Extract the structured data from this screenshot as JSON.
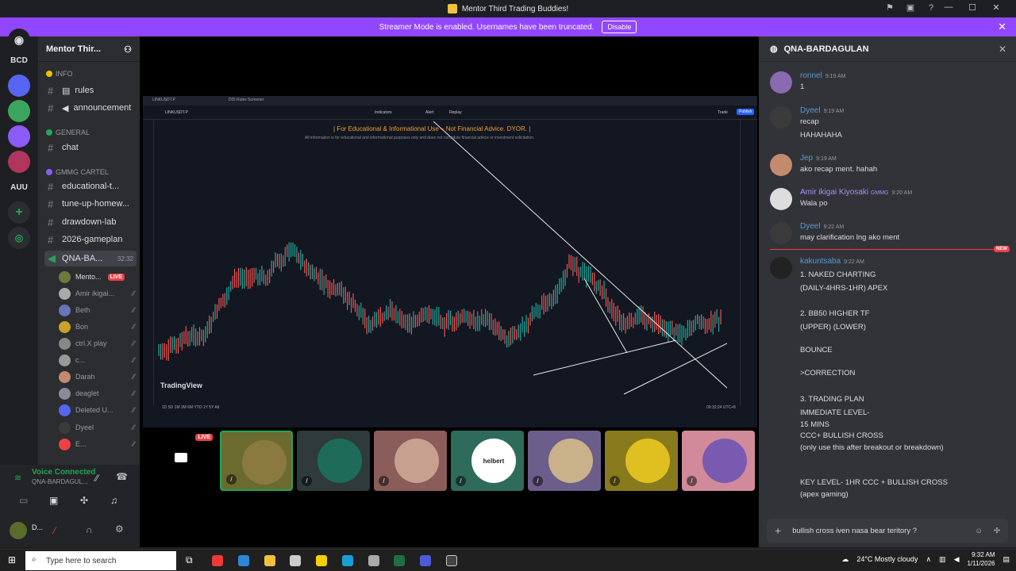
{
  "window": {
    "title": "Mentor Third Trading Buddies!"
  },
  "banner": {
    "text": "Streamer Mode is enabled. Usernames have been truncated.",
    "button": "Disable"
  },
  "rail": {
    "servers": [
      "BCD",
      "AUU"
    ]
  },
  "sidebar": {
    "server_name": "Mentor Thir...",
    "categories": [
      "INFO",
      "GENERAL",
      "GMMG CARTEL"
    ],
    "channels": [
      {
        "name": "rules",
        "icon": "document-icon"
      },
      {
        "name": "announcement",
        "icon": "megaphone-icon"
      },
      {
        "name": "chat"
      },
      {
        "name": "educational-t..."
      },
      {
        "name": "tune-up-homew..."
      },
      {
        "name": "drawdown-lab"
      },
      {
        "name": "2026-gameplan"
      }
    ],
    "voice_channel": {
      "name": "QNA-BA...",
      "time": "32:32"
    },
    "voice_users": [
      {
        "name": "Mento...",
        "live": "LIVE"
      },
      {
        "name": "Amir ikigai..."
      },
      {
        "name": "Beth"
      },
      {
        "name": "Bon"
      },
      {
        "name": "ctrl.X play"
      },
      {
        "name": "c..."
      },
      {
        "name": "Darah"
      },
      {
        "name": "deaglet"
      },
      {
        "name": "Deleted U..."
      },
      {
        "name": "Dyeel"
      },
      {
        "name": "E..."
      }
    ]
  },
  "voice_panel": {
    "status": "Voice Connected",
    "channel": "QNA-BARDAGUL...",
    "user": "D..."
  },
  "stream": {
    "live_badge": "LIVE",
    "tradingview": {
      "symbol": "LINKUSDT.P",
      "tab": "DDI Rules Screener",
      "disclaimer": "| For Educational & Informational Use – Not Financial Advice. DYOR. |",
      "disclaimer_sub": "All information is for educational and informational purposes only and does not constitute financial advice or investment solicitation.",
      "logo": "TradingView",
      "indicators": "Indicators",
      "alert": "Alert",
      "replay": "Replay",
      "trade": "Trade",
      "publish": "Publish",
      "timeframes": "1D  5D  1M  3M  6M  YTD  1Y  5Y  All",
      "clock": "09:32:24 UTC+8"
    },
    "tiles": [
      "helbert"
    ]
  },
  "chat": {
    "channel": "QNA-BARDAGULAN",
    "new_badge": "NEW",
    "messages": [
      {
        "user": "ronnel",
        "time": "9:19 AM",
        "lines": [
          "1"
        ],
        "color": "#5a9bd5"
      },
      {
        "user": "Dyeel",
        "time": "9:19 AM",
        "lines": [
          "recap",
          "HAHAHAHA"
        ],
        "color": "#5a9bd5"
      },
      {
        "user": "Jep",
        "time": "9:19 AM",
        "lines": [
          "ako recap ment. hahah"
        ],
        "color": "#5a9bd5"
      },
      {
        "user": "Amir ikigai Kiyosaki",
        "tag": "GMMG",
        "time": "9:20 AM",
        "lines": [
          "Wala po"
        ],
        "color": "#b28cf7"
      },
      {
        "user": "Dyeel",
        "time": "9:22 AM",
        "lines": [
          "may clarification lng ako ment"
        ],
        "color": "#5a9bd5"
      },
      {
        "user": "kakuntsaba",
        "time": "9:22 AM",
        "lines": [
          "1. NAKED CHARTING",
          "(DAILY-4HRS-1HR) APEX",
          "2. BB50 HIGHER TF",
          "(UPPER) (LOWER)",
          "BOUNCE",
          ">CORRECTION",
          "3. TRADING PLAN",
          "IMMEDIATE LEVEL-",
          "15 MINS",
          "CCC+ BULLISH CROSS",
          "(only use this after breakout or breakdown)",
          "KEY LEVEL- 1HR CCC + BULLISH CROSS",
          "(apex gaming)"
        ],
        "color": "#5a9bd5"
      }
    ],
    "input_value": "bullish cross iven nasa bear teritory ?"
  },
  "taskbar": {
    "search_placeholder": "Type here to search",
    "weather": "24°C  Mostly cloudy",
    "time": "9:32 AM",
    "date": "1/11/2026"
  }
}
